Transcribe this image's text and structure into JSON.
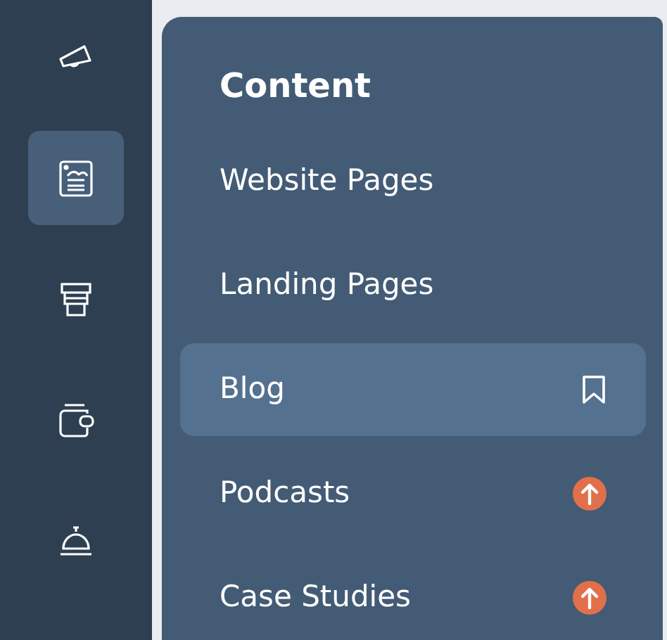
{
  "rail": [
    {
      "kind": "megaphone",
      "selected": false
    },
    {
      "kind": "content",
      "selected": true
    },
    {
      "kind": "store",
      "selected": false
    },
    {
      "kind": "wallet",
      "selected": false
    },
    {
      "kind": "bell",
      "selected": false
    }
  ],
  "menu": {
    "heading": "Content",
    "items": [
      {
        "label": "Website Pages",
        "selected": false,
        "kind": "plain"
      },
      {
        "label": "Landing Pages",
        "selected": false,
        "kind": "plain"
      },
      {
        "label": "Blog",
        "selected": true,
        "kind": "bookmark"
      },
      {
        "label": "Podcasts",
        "selected": false,
        "kind": "upgrade"
      },
      {
        "label": "Case Studies",
        "selected": false,
        "kind": "upgrade"
      }
    ]
  }
}
